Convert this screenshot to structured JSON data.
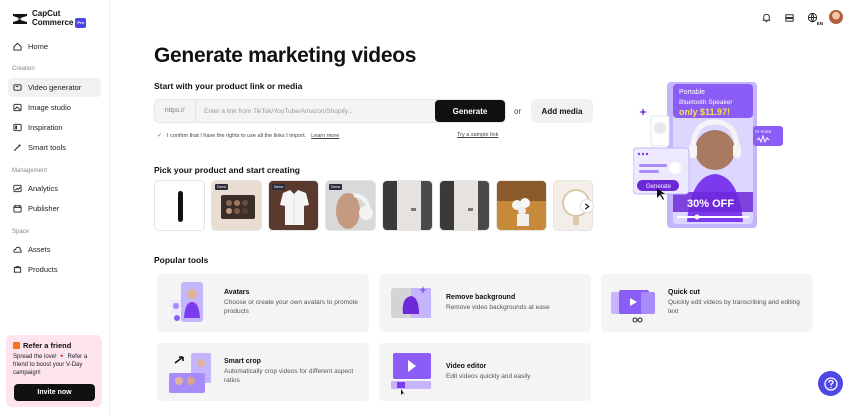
{
  "app": {
    "logo_line1": "CapCut",
    "logo_line2": "Commerce",
    "logo_badge": "Pro"
  },
  "sidebar": {
    "home": "Home",
    "sections": {
      "creation": "Creation",
      "management": "Management",
      "space": "Space"
    },
    "items": {
      "video_generator": "Video generator",
      "image_studio": "Image studio",
      "inspiration": "Inspiration",
      "smart_tools": "Smart tools",
      "analytics": "Analytics",
      "publisher": "Publisher",
      "assets": "Assets",
      "products": "Products"
    },
    "refer": {
      "title": "Refer a friend",
      "text": "Spread the love! 💌 Refer a friend to boost your V-Day campaign!",
      "button": "Invite now"
    }
  },
  "header": {
    "language": "EN"
  },
  "main": {
    "title": "Generate marketing videos",
    "start_heading": "Start with your product link or media",
    "link_prefix": "https://",
    "link_placeholder": "Enter a link from TikTok/YouTube/Amazon/Shopify...",
    "generate_button": "Generate",
    "or": "or",
    "add_media_button": "Add media",
    "consent_text": "I confirm that I have the rights to use all the links I import.",
    "learn_more": "Learn more",
    "try_sample": "Try a sample link",
    "pick_heading": "Pick your product and start creating",
    "demo_badge": "Demo",
    "popular_heading": "Popular tools",
    "tools": {
      "avatars": {
        "title": "Avatars",
        "desc": "Choose or create your own avatars to promote products"
      },
      "remove_bg": {
        "title": "Remove background",
        "desc": "Remove video backgrounds at ease"
      },
      "quick_cut": {
        "title": "Quick cut",
        "desc": "Quickly edit videos by transcribing and editing text"
      },
      "smart_crop": {
        "title": "Smart crop",
        "desc": "Automatically crop videos for different aspect ratios"
      },
      "video_editor": {
        "title": "Video editor",
        "desc": "Edit videos quickly and easily"
      }
    }
  },
  "promo": {
    "line1": "Portable",
    "line2": "Bluetooth Speaker",
    "price": "only $11.97!",
    "ai_voice": "AI Voice",
    "generate": "Generate",
    "discount": "30% OFF"
  },
  "colors": {
    "accent": "#4f46e5",
    "promo_purple": "#8b5cf6",
    "refer_bg": "#fde4ef"
  }
}
